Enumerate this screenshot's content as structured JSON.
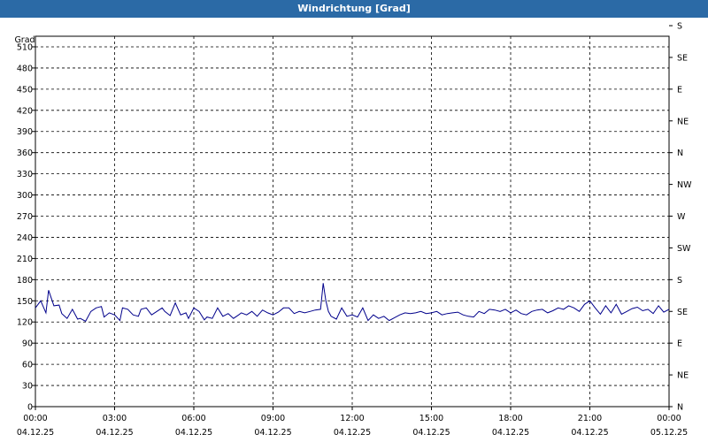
{
  "window": {
    "title": "Windrichtung [Grad]"
  },
  "chart_data": {
    "type": "line",
    "title": "Windrichtung [Grad]",
    "ylabel": "Grad",
    "ylim": [
      0,
      525
    ],
    "y_ticks": [
      0,
      30,
      60,
      90,
      120,
      150,
      180,
      210,
      240,
      270,
      300,
      330,
      360,
      390,
      420,
      450,
      480,
      510
    ],
    "right_axis_labels": [
      {
        "value": 0,
        "label": "N"
      },
      {
        "value": 45,
        "label": "NE"
      },
      {
        "value": 90,
        "label": "E"
      },
      {
        "value": 135,
        "label": "SE"
      },
      {
        "value": 180,
        "label": "S"
      },
      {
        "value": 225,
        "label": "SW"
      },
      {
        "value": 270,
        "label": "W"
      },
      {
        "value": 315,
        "label": "NW"
      },
      {
        "value": 360,
        "label": "N"
      },
      {
        "value": 405,
        "label": "NE"
      },
      {
        "value": 450,
        "label": "E"
      },
      {
        "value": 495,
        "label": "SE"
      },
      {
        "value": 540,
        "label": "S"
      }
    ],
    "x_range_hours": [
      0,
      24
    ],
    "x_ticks": [
      {
        "time": "00:00",
        "date": "04.12.25"
      },
      {
        "time": "03:00",
        "date": "04.12.25"
      },
      {
        "time": "06:00",
        "date": "04.12.25"
      },
      {
        "time": "09:00",
        "date": "04.12.25"
      },
      {
        "time": "12:00",
        "date": "04.12.25"
      },
      {
        "time": "15:00",
        "date": "04.12.25"
      },
      {
        "time": "18:00",
        "date": "04.12.25"
      },
      {
        "time": "21:00",
        "date": "04.12.25"
      },
      {
        "time": "00:00",
        "date": "05.12.25"
      }
    ],
    "grid": true,
    "series": [
      {
        "color": "#00008b",
        "x_hours": [
          0.0,
          0.2,
          0.4,
          0.5,
          0.7,
          0.9,
          1.0,
          1.2,
          1.4,
          1.6,
          1.7,
          1.9,
          2.1,
          2.3,
          2.5,
          2.6,
          2.8,
          3.0,
          3.2,
          3.3,
          3.5,
          3.7,
          3.9,
          4.0,
          4.2,
          4.4,
          4.6,
          4.8,
          4.9,
          5.1,
          5.3,
          5.5,
          5.7,
          5.8,
          6.0,
          6.2,
          6.4,
          6.5,
          6.7,
          6.9,
          7.1,
          7.3,
          7.5,
          7.7,
          7.8,
          8.0,
          8.2,
          8.4,
          8.6,
          8.8,
          9.0,
          9.2,
          9.4,
          9.6,
          9.8,
          10.0,
          10.2,
          10.4,
          10.6,
          10.8,
          10.9,
          11.0,
          11.1,
          11.2,
          11.4,
          11.6,
          11.8,
          12.0,
          12.2,
          12.4,
          12.6,
          12.8,
          13.0,
          13.2,
          13.4,
          13.6,
          13.8,
          14.0,
          14.2,
          14.4,
          14.6,
          14.8,
          15.0,
          15.2,
          15.4,
          15.6,
          15.8,
          16.0,
          16.2,
          16.4,
          16.6,
          16.8,
          17.0,
          17.2,
          17.4,
          17.6,
          17.8,
          18.0,
          18.2,
          18.4,
          18.6,
          18.8,
          19.0,
          19.2,
          19.4,
          19.6,
          19.8,
          20.0,
          20.2,
          20.4,
          20.6,
          20.8,
          21.0,
          21.2,
          21.4,
          21.6,
          21.8,
          22.0,
          22.2,
          22.4,
          22.6,
          22.8,
          23.0,
          23.2,
          23.4,
          23.6,
          23.8,
          24.0
        ],
        "values": [
          140,
          150,
          133,
          165,
          143,
          144,
          132,
          125,
          138,
          124,
          125,
          121,
          135,
          140,
          142,
          127,
          133,
          130,
          122,
          140,
          138,
          130,
          128,
          138,
          140,
          130,
          135,
          140,
          135,
          129,
          147,
          130,
          133,
          125,
          140,
          135,
          123,
          127,
          125,
          140,
          128,
          132,
          125,
          130,
          133,
          130,
          135,
          128,
          137,
          133,
          130,
          134,
          140,
          140,
          132,
          135,
          133,
          135,
          137,
          138,
          175,
          150,
          135,
          128,
          124,
          140,
          128,
          130,
          127,
          140,
          122,
          130,
          125,
          128,
          122,
          126,
          130,
          133,
          132,
          133,
          135,
          132,
          133,
          135,
          130,
          132,
          133,
          134,
          130,
          128,
          127,
          135,
          132,
          138,
          137,
          135,
          138,
          133,
          137,
          132,
          130,
          135,
          137,
          138,
          133,
          136,
          140,
          138,
          143,
          140,
          135,
          145,
          150,
          140,
          131,
          143,
          133,
          145,
          131,
          135,
          139,
          141,
          136,
          138,
          132,
          143,
          134,
          138,
          136
        ]
      }
    ]
  }
}
